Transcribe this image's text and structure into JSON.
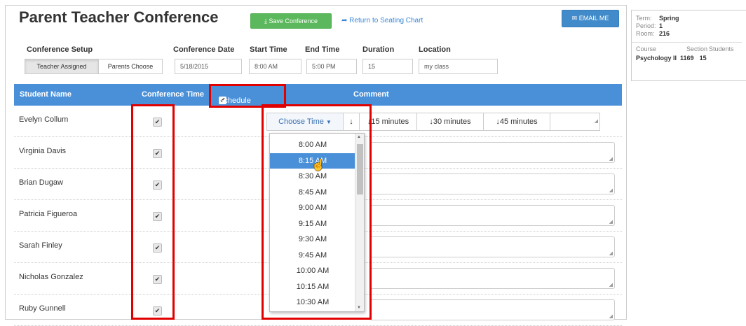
{
  "header": {
    "title": "Parent Teacher Conference",
    "save_label": "Save Conference",
    "return_label": "Return to Seating Chart",
    "email_label": "EMAIL ME"
  },
  "setup": {
    "conference_setup_label": "Conference Setup",
    "teacher_assigned": "Teacher Assigned",
    "parents_choose": "Parents Choose",
    "date_label": "Conference Date",
    "date_value": "5/18/2015",
    "start_label": "Start Time",
    "start_value": "8:00 AM",
    "end_label": "End Time",
    "end_value": "5:00 PM",
    "duration_label": "Duration",
    "duration_value": "15",
    "location_label": "Location",
    "location_value": "my class"
  },
  "table": {
    "col_student": "Student Name",
    "col_time": "Conference Time",
    "schedule_all": "Schedule All",
    "col_comment": "Comment",
    "students": [
      "Evelyn Collum",
      "Virginia Davis",
      "Brian Dugaw",
      "Patricia Figueroa",
      "Sarah Finley",
      "Nicholas Gonzalez",
      "Ruby Gunnell"
    ]
  },
  "time_picker": {
    "choose_label": "Choose Time",
    "opt15": "15 minutes",
    "opt30": "30 minutes",
    "opt45": "45 minutes",
    "selected": "8:15 AM",
    "options": [
      "8:00 AM",
      "8:15 AM",
      "8:30 AM",
      "8:45 AM",
      "9:00 AM",
      "9:15 AM",
      "9:30 AM",
      "9:45 AM",
      "10:00 AM",
      "10:15 AM",
      "10:30 AM"
    ]
  },
  "info": {
    "term_label": "Term:",
    "term_value": "Spring",
    "period_label": "Period:",
    "period_value": "1",
    "room_label": "Room:",
    "room_value": "216",
    "course_label": "Course",
    "section_label": "Section",
    "students_label": "Students",
    "course_value": "Psychology II",
    "section_value": "1169",
    "students_value": "15"
  },
  "colors": {
    "header_blue": "#4a90d9",
    "save_green": "#5cb85c",
    "highlight_red": "#e00000"
  }
}
